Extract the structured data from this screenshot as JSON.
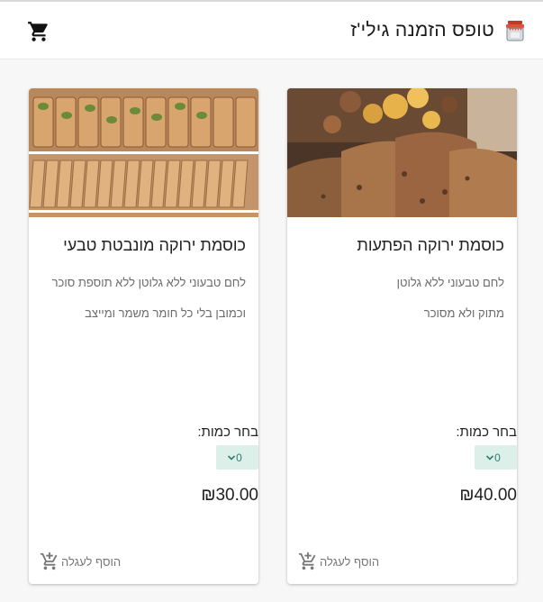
{
  "header": {
    "title": "טופס הזמנה גילי'ז",
    "cart_icon": "shopping-cart-icon",
    "brand_icon": "jar-icon"
  },
  "products": [
    {
      "title": "כוסמת ירוקה הפתעות",
      "desc_line1": "לחם טבעוני ללא גלוטן",
      "desc_line2": "מתוק ולא מסוכר",
      "qty_label": "בחר כמות:",
      "qty_value": "0",
      "price": "₪40.00",
      "add_label": "הוסף לעגלה"
    },
    {
      "title": "כוסמת ירוקה מונבטת טבעי",
      "desc_line1": "לחם טבעוני ללא גלוטן ללא תוספת סוכר",
      "desc_line2": "וכמובן בלי כל חומר משמר ומייצב",
      "qty_label": "בחר כמות:",
      "qty_value": "0",
      "price": "₪30.00",
      "add_label": "הוסף לעגלה"
    }
  ],
  "colors": {
    "accent": "#2b7f6c",
    "select_bg": "#dcefe8"
  }
}
